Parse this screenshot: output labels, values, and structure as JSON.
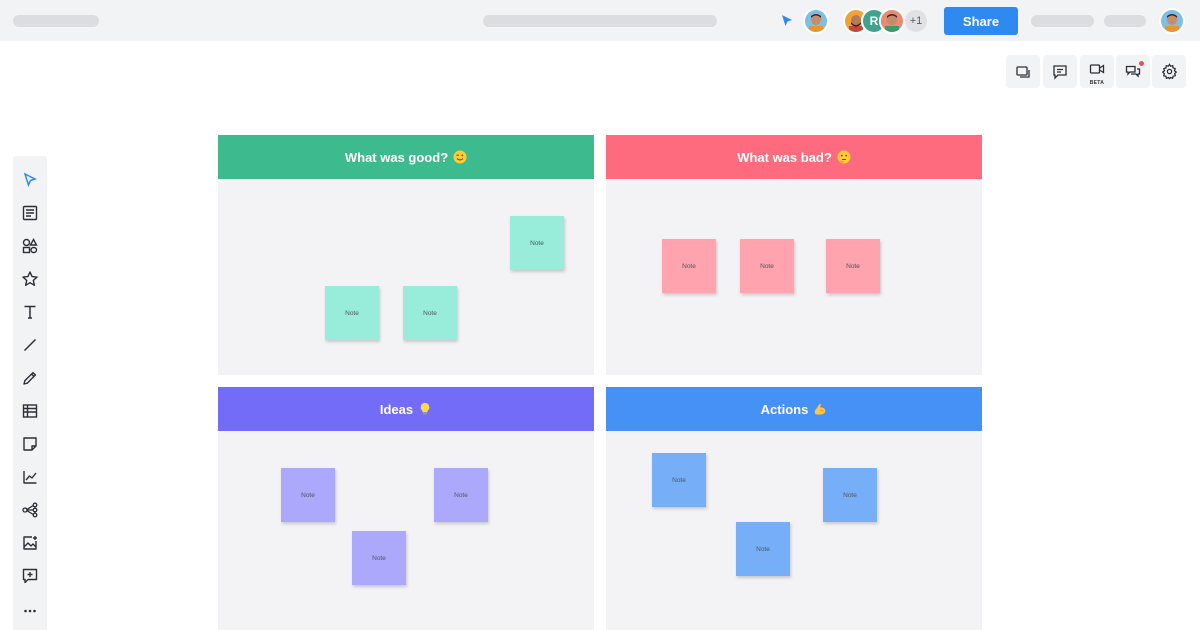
{
  "toolbar": {
    "share_label": "Share"
  },
  "collaborators": {
    "letter_initial": "R",
    "more_count": "+1"
  },
  "right_tools": {
    "video_badge": "BETA"
  },
  "sections": {
    "good": {
      "title": "What was good?",
      "color": "#3dbb8e",
      "note_color": "#97ecda"
    },
    "bad": {
      "title": "What was bad?",
      "color": "#ff6b7e",
      "note_color": "#ffa3ae"
    },
    "ideas": {
      "title": "Ideas",
      "color": "#736cf9",
      "note_color": "#aca8fb"
    },
    "actions": {
      "title": "Actions",
      "color": "#4691f6",
      "note_color": "#76aef8"
    }
  },
  "notes": {
    "label": "Note"
  }
}
